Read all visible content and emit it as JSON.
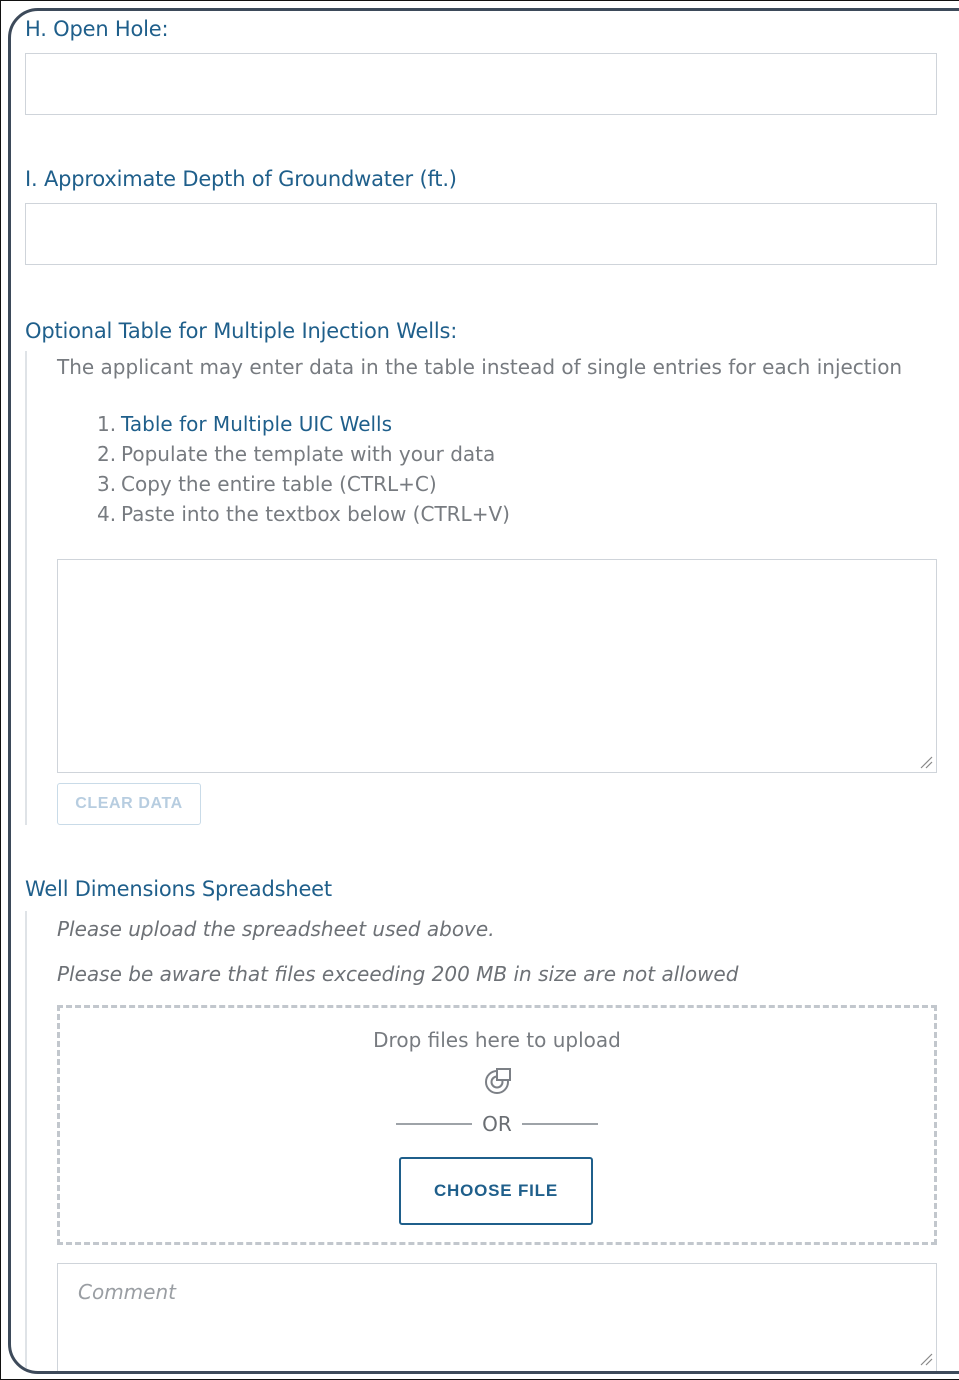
{
  "fields": {
    "open_hole": {
      "label": "H. Open Hole:",
      "value": ""
    },
    "groundwater_depth": {
      "label": "I. Approximate Depth of Groundwater (ft.)",
      "value": ""
    }
  },
  "optional_table": {
    "title": "Optional Table for Multiple Injection Wells:",
    "description": "The applicant may enter data in the table instead of single entries for each injection",
    "steps": [
      {
        "num": "1.",
        "text": "Table for Multiple UIC Wells",
        "is_link": true
      },
      {
        "num": "2.",
        "text": "Populate the template with your data",
        "is_link": false
      },
      {
        "num": "3.",
        "text": "Copy the entire table (CTRL+C)",
        "is_link": false
      },
      {
        "num": "4.",
        "text": "Paste into the textbox below (CTRL+V)",
        "is_link": false
      }
    ],
    "textarea_value": "",
    "clear_button": "CLEAR DATA"
  },
  "spreadsheet": {
    "title": "Well Dimensions Spreadsheet",
    "note_upload": "Please upload the spreadsheet used above.",
    "note_size": "Please be aware that files exceeding 200 MB in size are not allowed",
    "dropzone": {
      "text": "Drop files here to upload",
      "icon": "upload-cloud-icon",
      "or_text": "OR",
      "choose_button": "CHOOSE FILE"
    },
    "comment_placeholder": "Comment"
  },
  "colors": {
    "label_blue": "#1f5f8b",
    "panel_border": "#3d4a5a",
    "muted_text": "#777b80",
    "disabled_button": "#b7cde0"
  }
}
